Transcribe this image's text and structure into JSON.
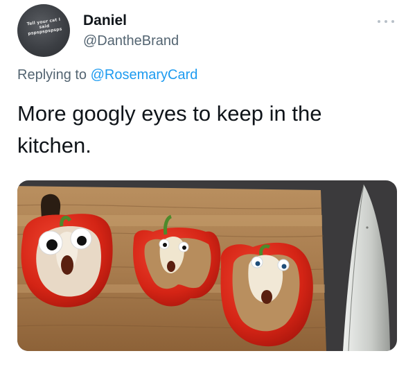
{
  "tweet": {
    "author": {
      "display_name": "Daniel",
      "handle": "@DantheBrand",
      "avatar_text": "Tell your cat I said pspspspspsps"
    },
    "more_icon": "more-horizontal-icon",
    "reply": {
      "prefix": "Replying to",
      "mention": "@RosemaryCard"
    },
    "text": "More googly eyes to keep in the kitchen.",
    "media": {
      "subject": "red bell pepper halves with googly eyes on a wooden cutting board next to a knife"
    }
  },
  "colors": {
    "text": "#0f1419",
    "secondary": "#536471",
    "link": "#1d9bf0",
    "pepper_red": "#d42415"
  }
}
